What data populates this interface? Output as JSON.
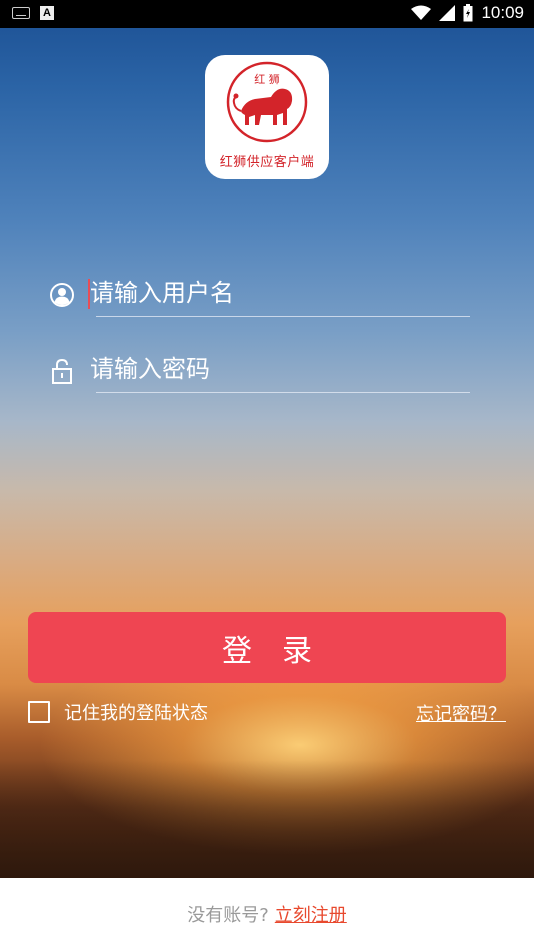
{
  "status_bar": {
    "time": "10:09",
    "icons": [
      "keyboard-icon",
      "a-notification-icon",
      "wifi-icon",
      "signal-icon",
      "battery-icon"
    ]
  },
  "logo": {
    "top_text": "红 狮",
    "caption": "红狮供应客户端",
    "brand_color": "#d3242a"
  },
  "form": {
    "username_placeholder": "请输入用户名",
    "password_placeholder": "请输入密码",
    "login_label": "登录",
    "remember_label": "记住我的登陆状态",
    "forgot_label": "忘记密码？",
    "accent_color": "#ef4552"
  },
  "footer": {
    "no_account": "没有账号?",
    "register_link": "立刻注册",
    "link_color": "#e8492e"
  }
}
